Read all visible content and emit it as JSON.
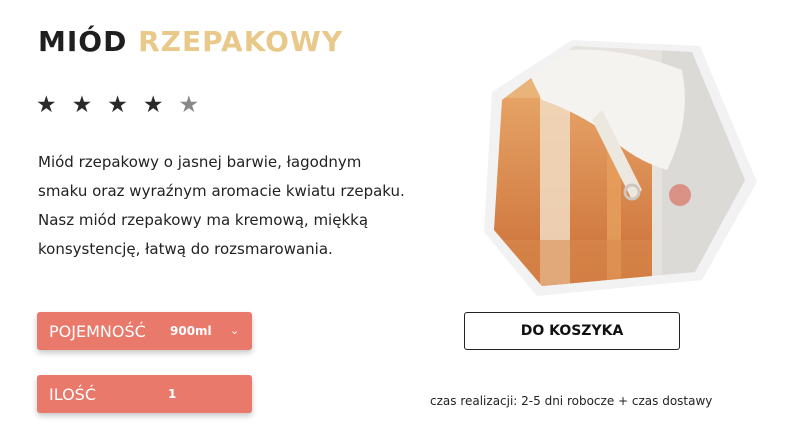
{
  "product": {
    "title_part1": "MIÓD",
    "title_part2": "RZEPAKOWY",
    "title_accent_color": "#e8c98a",
    "rating": {
      "value": 4,
      "max": 5
    },
    "description": "Miód rzepakowy o jasnej barwie, łagodnym smaku oraz wyraźnym aromacie kwiatu rzepaku. Nasz miód rzepakowy ma kremową, miękką konsystencję, łatwą do rozsmarowania."
  },
  "options": {
    "capacity": {
      "label": "POJEMNOŚĆ",
      "value": "900ml",
      "icon": "chevron-down-icon"
    },
    "quantity": {
      "label": "ILOŚĆ",
      "value": "1"
    },
    "accent_color": "#e8796b"
  },
  "cart": {
    "button_label": "DO KOSZYKA",
    "note": "czas realizacji: 2-5 dni robocze + czas dostawy"
  }
}
